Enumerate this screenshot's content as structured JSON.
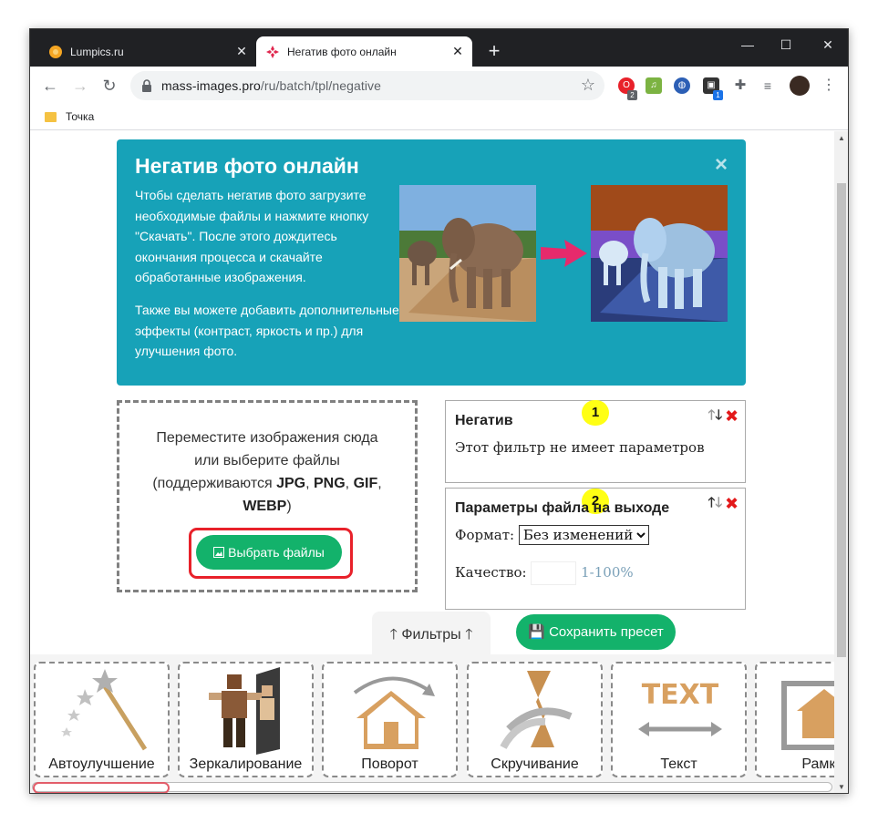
{
  "browser": {
    "tabs": [
      {
        "title": "Lumpics.ru",
        "active": false
      },
      {
        "title": "Негатив фото онлайн",
        "active": true
      }
    ],
    "url_host": "mass-images.pro",
    "url_path": "/ru/batch/tpl/negative",
    "bookmark": "Точка",
    "extension_badges": [
      "2",
      "1"
    ]
  },
  "hero": {
    "title": "Негатив фото онлайн",
    "para1": "Чтобы сделать негатив фото загрузите необходимые файлы и нажмите кнопку \"Скачать\". После этого дождитесь окончания процесса и скачайте обработанные изображения.",
    "para2": "Также вы можете добавить дополнительные эффекты (контраст, яркость и пр.) для улучшения фото.",
    "close": "×"
  },
  "upload": {
    "line1": "Переместите изображения сюда",
    "line2": "или выберите файлы",
    "formats_prefix": "(поддерживаются ",
    "formats": [
      "JPG",
      "PNG",
      "GIF",
      "WEBP"
    ],
    "formats_suffix": ")",
    "button": "Выбрать файлы"
  },
  "filters": [
    {
      "number": "1",
      "title": "Негатив",
      "body": "Этот фильтр не имеет параметров"
    },
    {
      "number": "2",
      "title": "Параметры файла на выходе",
      "format_label": "Формат:",
      "format_value": "Без изменений",
      "quality_label": "Качество:",
      "quality_hint": "1-100%"
    }
  ],
  "filters_tab": "Фильтры",
  "save_preset": "Сохранить пресет",
  "tools": [
    "Автоулучшение",
    "Зеркалирование",
    "Поворот",
    "Скручивание",
    "Текст",
    "Рамка"
  ],
  "colors": {
    "accent_teal": "#17a2b8",
    "button_green": "#13b26b",
    "highlight_red": "#e8212a",
    "number_yellow": "#ffff14"
  }
}
